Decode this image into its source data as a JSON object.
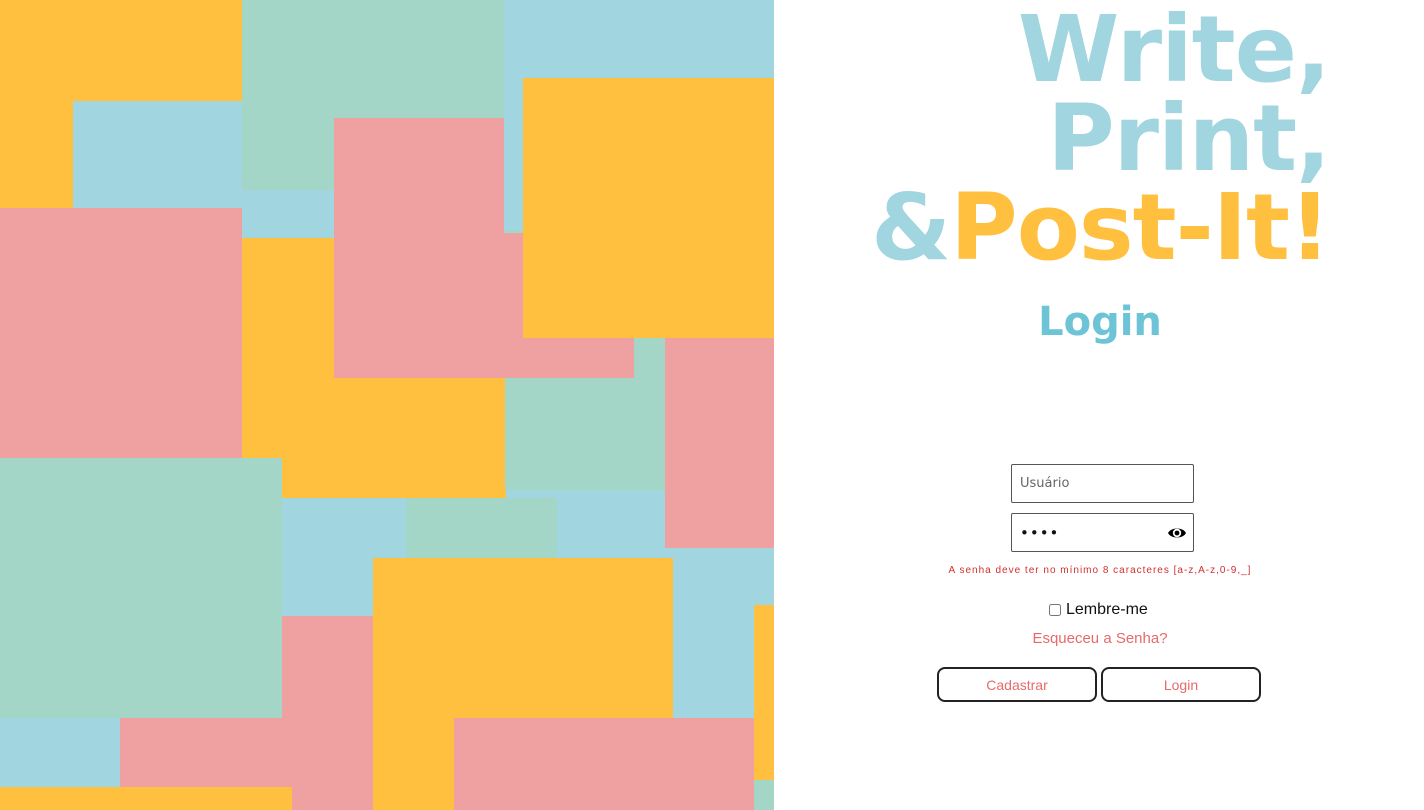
{
  "headline": {
    "line1": "Write,",
    "line2": "Print,",
    "line3_amp": "&",
    "line3_post": "Post-It!"
  },
  "login": {
    "title": "Login",
    "username_placeholder": "Usuário",
    "password_value": "••••",
    "password_hint": "A senha deve ter no mínimo 8 caracteres [a-z,A-z,0-9,_]",
    "remember_label": "Lembre-me",
    "remember_checked": false,
    "forgot_link": "Esqueceu a Senha?",
    "register_button": "Cadastrar",
    "login_button": "Login"
  },
  "icons": {
    "password_toggle": "eye-icon"
  },
  "colors": {
    "yellow": "#ffc03f",
    "blue": "#a1d5df",
    "green": "#a3d6c6",
    "pink": "#efa1a1",
    "title_blue": "#6cc4d6",
    "link_red": "#e86a6a",
    "hint_red": "#d32f2f"
  }
}
